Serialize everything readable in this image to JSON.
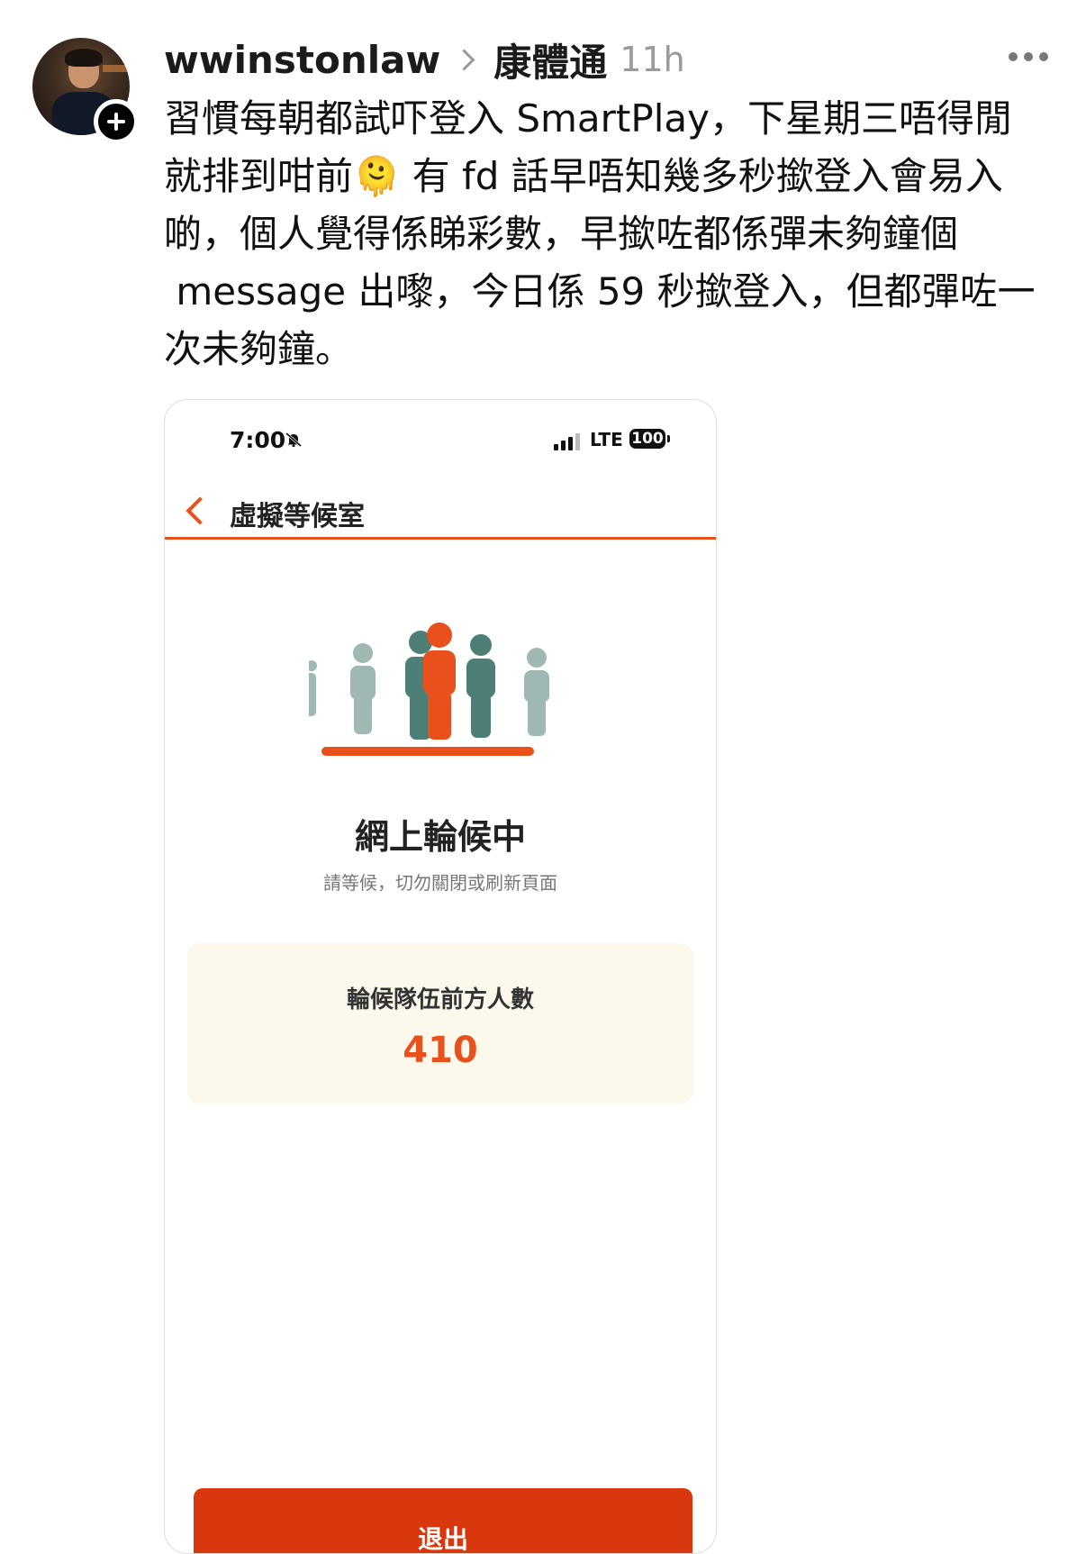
{
  "post": {
    "username": "wwinstonlaw",
    "community": "康體通",
    "time": "11h",
    "text": "習慣每朝都試吓登入 SmartPlay，下星期三唔得閒\n就排到咁前🫠 有 fd 話早唔知幾多秒撳登入會易入\n啲，個人覺得係睇彩數，早撳咗都係彈未夠鐘個\n message 出嚟，今日係 59 秒撳登入，但都彈咗一\n次未夠鐘。"
  },
  "icons": {
    "follow": "plus-icon",
    "more": "more-icon",
    "bell": "bell-off-icon",
    "back": "chevron-left-icon"
  },
  "screenshot": {
    "status": {
      "time": "7:00",
      "network": "LTE",
      "battery": "100"
    },
    "nav_title": "虛擬等候室",
    "queue_title": "網上輪候中",
    "queue_subtitle": "請等候，切勿關閉或刷新頁面",
    "count_label": "輪候隊伍前方人數",
    "count_value": "410",
    "exit_label": "退出"
  },
  "colors": {
    "accent": "#e8501c",
    "button": "#d9380e",
    "teal": "#4e7f76",
    "teal_light": "#9fb8b3",
    "card_bg": "#fdf8ec"
  }
}
